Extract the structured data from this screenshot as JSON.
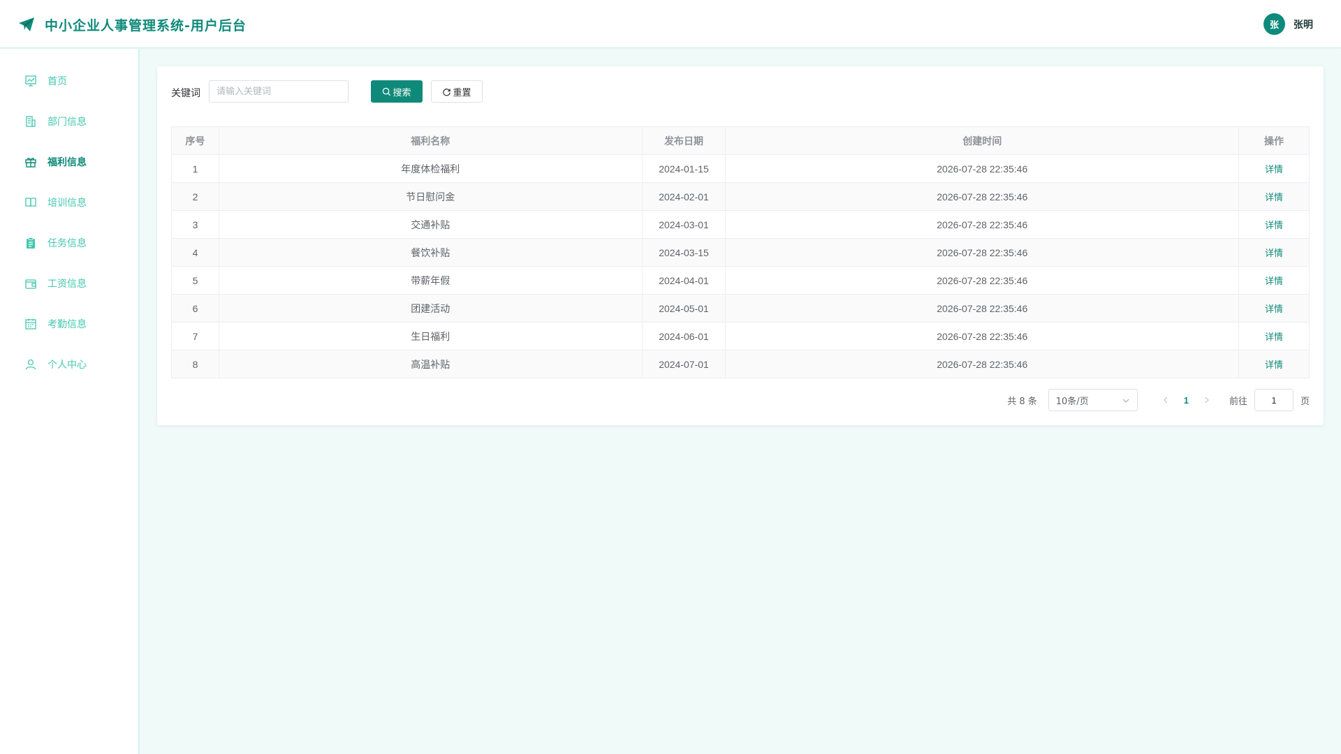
{
  "header": {
    "title": "中小企业人事管理系统-用户后台",
    "user_avatar_text": "张",
    "user_name": "张明",
    "logo_icon": "paper-plane-icon"
  },
  "colors": {
    "accent": "#0f8a7a",
    "menu_text": "#44c7b0",
    "background": "#f0fbf9"
  },
  "sidebar": {
    "items": [
      {
        "label": "首页",
        "icon": "dashboard-icon"
      },
      {
        "label": "部门信息",
        "icon": "building-icon"
      },
      {
        "label": "福利信息",
        "icon": "gift-icon",
        "active": true
      },
      {
        "label": "培训信息",
        "icon": "book-icon"
      },
      {
        "label": "任务信息",
        "icon": "clipboard-icon"
      },
      {
        "label": "工资信息",
        "icon": "wallet-icon"
      },
      {
        "label": "考勤信息",
        "icon": "calendar-icon"
      },
      {
        "label": "个人中心",
        "icon": "user-icon"
      }
    ]
  },
  "search": {
    "label": "关键词",
    "placeholder": "请输入关键词",
    "value": "",
    "search_button": "搜索",
    "reset_button": "重置"
  },
  "table": {
    "columns": [
      "序号",
      "福利名称",
      "发布日期",
      "创建时间",
      "操作"
    ],
    "rows": [
      {
        "index": "1",
        "name": "年度体检福利",
        "date": "2024-01-15",
        "created": "2026-07-28 22:35:46",
        "action": "详情"
      },
      {
        "index": "2",
        "name": "节日慰问金",
        "date": "2024-02-01",
        "created": "2026-07-28 22:35:46",
        "action": "详情"
      },
      {
        "index": "3",
        "name": "交通补贴",
        "date": "2024-03-01",
        "created": "2026-07-28 22:35:46",
        "action": "详情"
      },
      {
        "index": "4",
        "name": "餐饮补贴",
        "date": "2024-03-15",
        "created": "2026-07-28 22:35:46",
        "action": "详情"
      },
      {
        "index": "5",
        "name": "带薪年假",
        "date": "2024-04-01",
        "created": "2026-07-28 22:35:46",
        "action": "详情"
      },
      {
        "index": "6",
        "name": "团建活动",
        "date": "2024-05-01",
        "created": "2026-07-28 22:35:46",
        "action": "详情"
      },
      {
        "index": "7",
        "name": "生日福利",
        "date": "2024-06-01",
        "created": "2026-07-28 22:35:46",
        "action": "详情"
      },
      {
        "index": "8",
        "name": "高温补贴",
        "date": "2024-07-01",
        "created": "2026-07-28 22:35:46",
        "action": "详情"
      }
    ]
  },
  "pagination": {
    "total": "共 8 条",
    "page_size": "10条/页",
    "current_page": "1",
    "goto_label": "前往",
    "goto_value": "1",
    "page_suffix": "页"
  }
}
